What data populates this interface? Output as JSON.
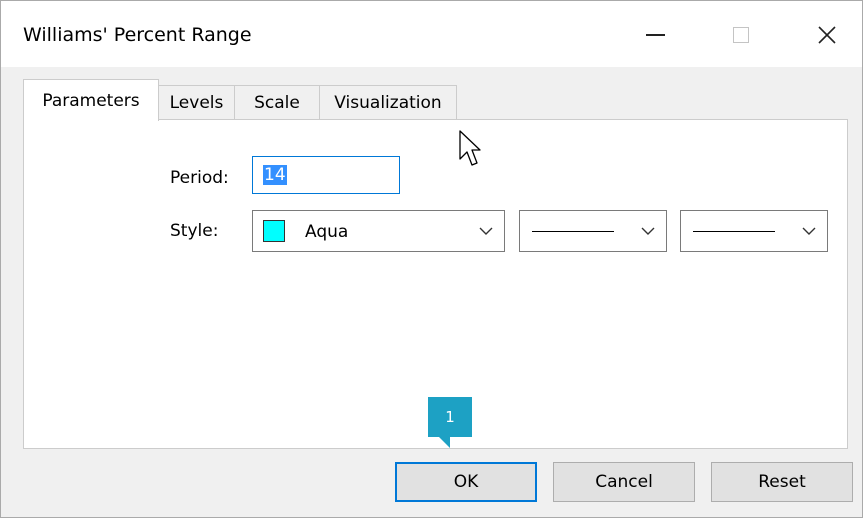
{
  "window": {
    "title": "Williams' Percent Range",
    "controls": {
      "minimize_icon": "minimize-icon",
      "maximize_icon": "maximize-icon",
      "close_icon": "close-icon"
    }
  },
  "tabs": [
    {
      "label": "Parameters",
      "active": true
    },
    {
      "label": "Levels",
      "active": false
    },
    {
      "label": "Scale",
      "active": false
    },
    {
      "label": "Visualization",
      "active": false
    }
  ],
  "parameters": {
    "period_label": "Period:",
    "period_value": "14",
    "style_label": "Style:",
    "color": {
      "name": "Aqua",
      "hex": "#00ffff"
    },
    "line_style_icon": "solid-line",
    "line_width_icon": "thin-line"
  },
  "callout": {
    "number": "1",
    "color": "#1da1c4"
  },
  "buttons": {
    "ok": "OK",
    "cancel": "Cancel",
    "reset": "Reset"
  },
  "colors": {
    "focus_accent": "#0078d7",
    "selection": "#3390ff"
  }
}
